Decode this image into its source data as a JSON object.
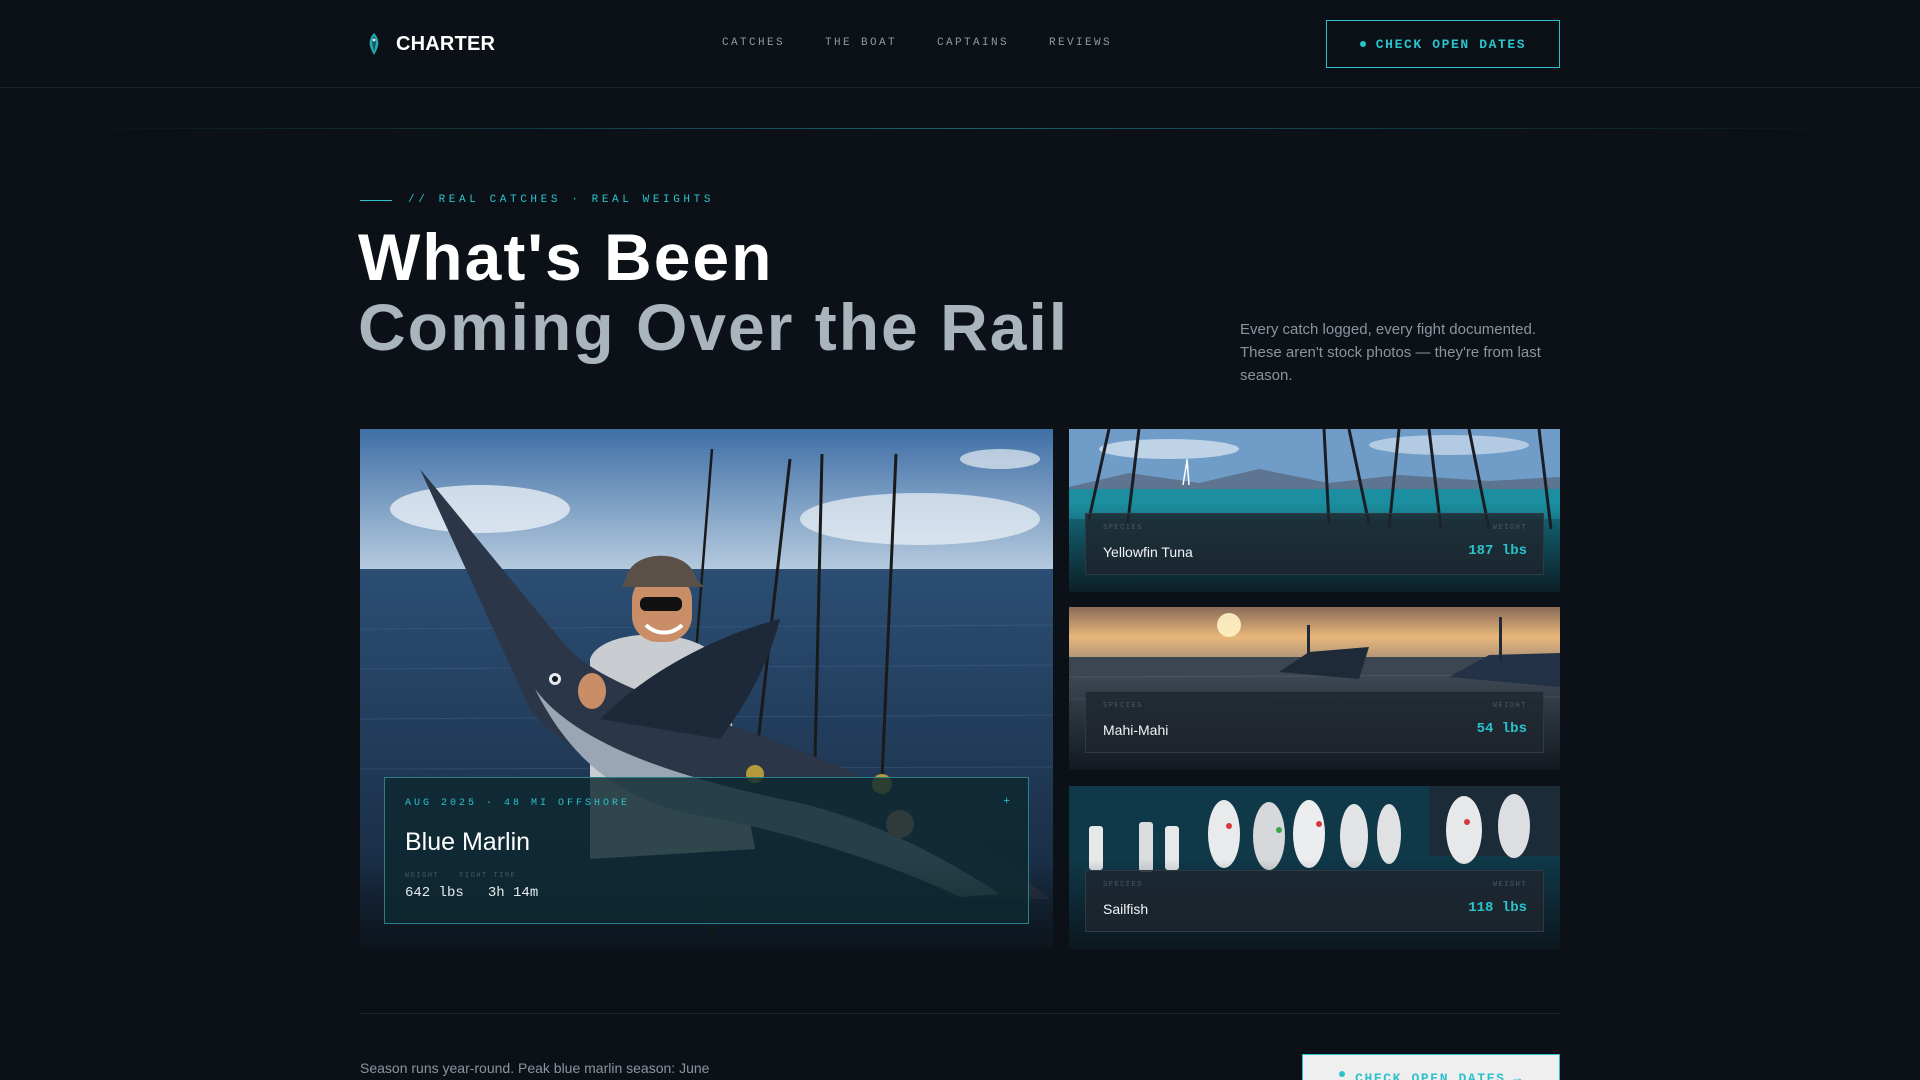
{
  "brand": {
    "name": "CHARTER",
    "icon": "fish-icon"
  },
  "nav": {
    "links": [
      "CATCHES",
      "THE BOAT",
      "CAPTAINS",
      "REVIEWS"
    ]
  },
  "cta": {
    "top_label": "CHECK OPEN DATES",
    "bottom_label": "CHECK OPEN DATES",
    "bottom_icon": "arrow-right-icon"
  },
  "hero": {
    "eyebrow": "// REAL CATCHES · REAL WEIGHTS",
    "headline_line1": "What's Been",
    "headline_line2": "Coming Over the Rail",
    "intro": "Every catch logged, every fight documented. These aren't stock photos — they're from last season."
  },
  "featured": {
    "meta": "AUG 2025 · 48 MI OFFSHORE",
    "plus": "+",
    "title": "Blue Marlin",
    "weight_label": "WEIGHT",
    "time_label": "FIGHT TIME",
    "weight": "642 lbs",
    "fight_time": "3h 14m"
  },
  "catches": [
    {
      "species_label": "SPECIES",
      "weight_label": "WEIGHT",
      "name": "Yellowfin Tuna",
      "weight": "187 lbs"
    },
    {
      "species_label": "SPECIES",
      "weight_label": "WEIGHT",
      "name": "Mahi-Mahi",
      "weight": "54 lbs"
    },
    {
      "species_label": "SPECIES",
      "weight_label": "WEIGHT",
      "name": "Sailfish",
      "weight": "118 lbs"
    }
  ],
  "footer": {
    "season_text": "Season runs year-round. Peak blue marlin season: June"
  },
  "colors": {
    "accent": "#2bc2cc",
    "background": "#0b1117",
    "text": "#ffffff",
    "muted": "#8a959e"
  }
}
